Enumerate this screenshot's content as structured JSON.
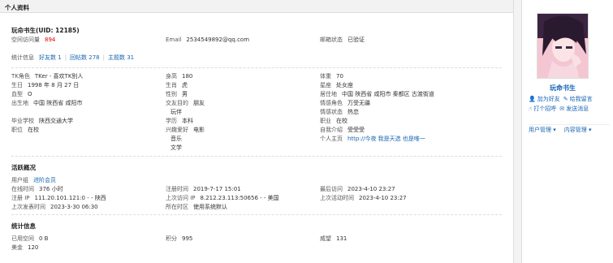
{
  "header": {
    "title": "个人资料"
  },
  "user": {
    "name_uid": "玩命书生(UID: 12185)",
    "display_name": "玩命书生"
  },
  "basic": {
    "visits_label": "空间访问量",
    "visits_value": "894",
    "email_label": "Email",
    "email_value": "2534549892@qq.com",
    "mailstatus_label": "邮箱状态",
    "mailstatus_value": "已验证"
  },
  "stats": {
    "label": "统计信息",
    "friends": "好友数 1",
    "replies": "回帖数 278",
    "threads": "主题数 31"
  },
  "details": {
    "col1": [
      {
        "label": "TK角色",
        "value": "TKer - 喜欢TK别人"
      },
      {
        "label": "生日",
        "value": "1998 年 8 月 27 日"
      },
      {
        "label": "血型",
        "value": "O"
      },
      {
        "label": "出生地",
        "value": "中国 陕西省 咸阳市"
      },
      {
        "label": "",
        "value": ""
      },
      {
        "label": "毕业学校",
        "value": "陕西交通大学"
      },
      {
        "label": "职位",
        "value": "在校"
      }
    ],
    "col2": [
      {
        "label": "身高",
        "value": "180"
      },
      {
        "label": "生肖",
        "value": "虎"
      },
      {
        "label": "性别",
        "value": "男"
      },
      {
        "label": "交友目的",
        "value": "朋友"
      },
      {
        "label": "",
        "value": "玩伴"
      },
      {
        "label": "学历",
        "value": "本科"
      },
      {
        "label": "兴趣爱好",
        "value": "电影"
      },
      {
        "label": "",
        "value": "音乐"
      },
      {
        "label": "",
        "value": "文学"
      }
    ],
    "col3": [
      {
        "label": "体重",
        "value": "70"
      },
      {
        "label": "星座",
        "value": "处女座"
      },
      {
        "label": "居住地",
        "value": "中国 陕西省 咸阳市 秦都区 古渡街道"
      },
      {
        "label": "情感角色",
        "value": "万受无疆"
      },
      {
        "label": "情感状态",
        "value": "热恋"
      },
      {
        "label": "职业",
        "value": "在校"
      },
      {
        "label": "自我介绍",
        "value": "受受受"
      },
      {
        "label": "个人主页",
        "value": "http://今夜 我是天选 也是唯一"
      }
    ]
  },
  "activity": {
    "title": "活跃概况",
    "group_label": "用户组",
    "group_value": "进阶会员",
    "rows": [
      [
        {
          "label": "在线时间",
          "value": "376 小时"
        },
        {
          "label": "注册时间",
          "value": "2019-7-17 15:01"
        },
        {
          "label": "最后访问",
          "value": "2023-4-10 23:27"
        }
      ],
      [
        {
          "label": "注册 IP",
          "value": "111.20.101.121:0 - - 陕西"
        },
        {
          "label": "上次访问 IP",
          "value": "8.212.23.113:50656 - - 美国"
        },
        {
          "label": "上次活动时间",
          "value": "2023-4-10 23:27"
        }
      ],
      [
        {
          "label": "上次发表时间",
          "value": "2023-3-30 06:30"
        },
        {
          "label": "所在时区",
          "value": "使用系统默认"
        },
        {
          "label": "",
          "value": ""
        }
      ]
    ]
  },
  "statinfo": {
    "title": "统计信息",
    "rows": [
      [
        {
          "label": "已用空间",
          "value": "0 B"
        },
        {
          "label": "积分",
          "value": "995"
        },
        {
          "label": "威望",
          "value": "131"
        }
      ],
      [
        {
          "label": "美金",
          "value": "120"
        },
        {
          "label": "",
          "value": ""
        },
        {
          "label": "",
          "value": ""
        }
      ]
    ]
  },
  "sidebar": {
    "actions": [
      {
        "icon": "add-friend-icon",
        "glyph": "👤",
        "label": "加为好友"
      },
      {
        "icon": "message-icon",
        "glyph": "✎",
        "label": "给我留言"
      },
      {
        "icon": "poke-icon",
        "glyph": "☝",
        "label": "打个招呼"
      },
      {
        "icon": "mail-icon",
        "glyph": "✉",
        "label": "发送消息"
      }
    ],
    "menu": [
      "用户管理 ▾",
      "内容管理 ▾"
    ]
  }
}
